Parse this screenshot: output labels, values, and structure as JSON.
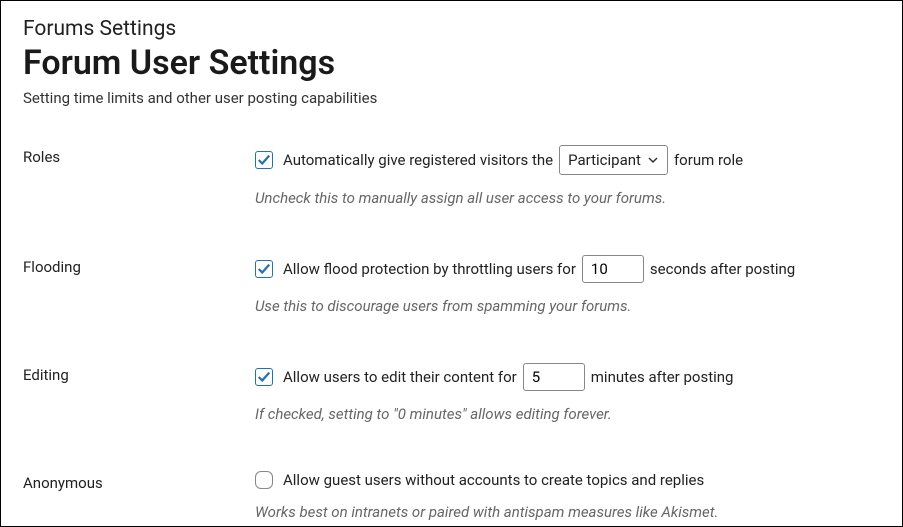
{
  "breadcrumb": "Forums Settings",
  "title": "Forum User Settings",
  "subtitle": "Setting time limits and other user posting capabilities",
  "roles": {
    "label": "Roles",
    "text_before": "Automatically give registered visitors the",
    "select_value": "Participant",
    "text_after": "forum role",
    "help": "Uncheck this to manually assign all user access to your forums."
  },
  "flooding": {
    "label": "Flooding",
    "text_before": "Allow flood protection by throttling users for",
    "input_value": "10",
    "text_after": "seconds after posting",
    "help": "Use this to discourage users from spamming your forums."
  },
  "editing": {
    "label": "Editing",
    "text_before": "Allow users to edit their content for",
    "input_value": "5",
    "text_after": "minutes after posting",
    "help": "If checked, setting to \"0 minutes\" allows editing forever."
  },
  "anonymous": {
    "label": "Anonymous",
    "text": "Allow guest users without accounts to create topics and replies",
    "help": "Works best on intranets or paired with antispam measures like Akismet."
  }
}
